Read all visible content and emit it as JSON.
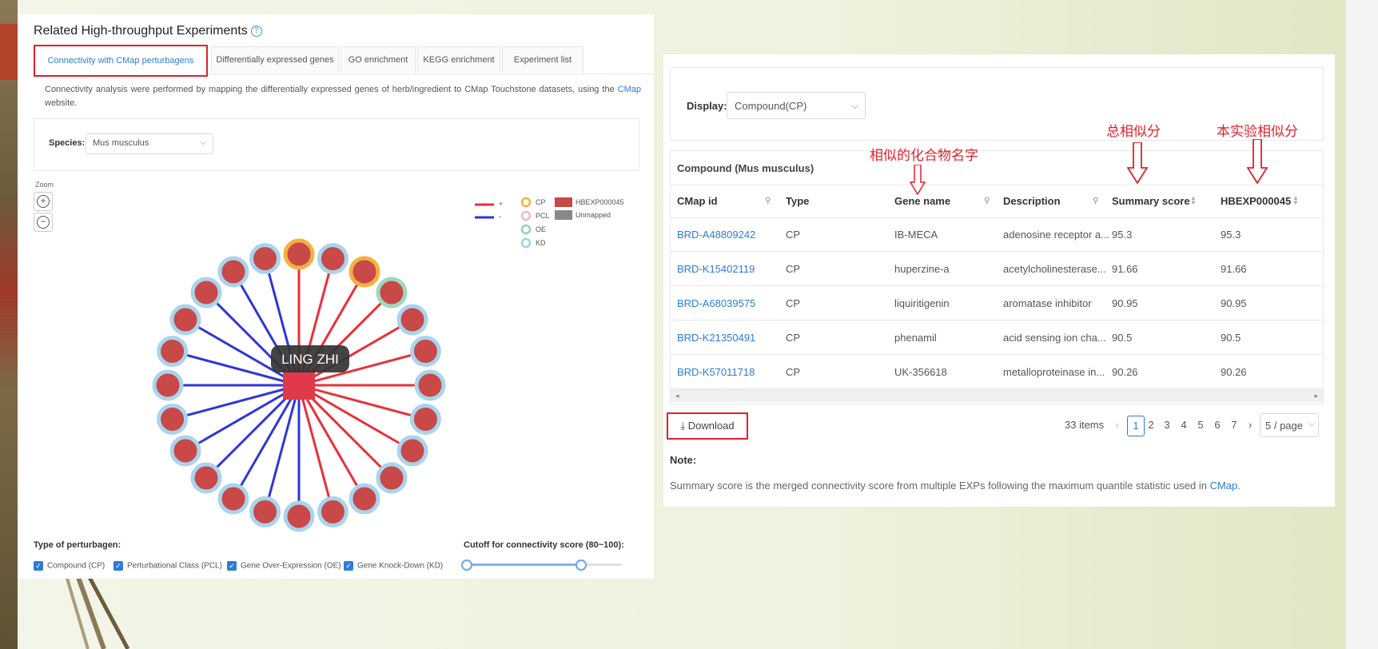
{
  "left": {
    "title": "Related High-throughput Experiments",
    "help_icon": "?",
    "tabs": [
      {
        "label": "Connectivity with CMap perturbagens"
      },
      {
        "label": "Differentially expressed genes"
      },
      {
        "label": "GO enrichment"
      },
      {
        "label": "KEGG enrichment"
      },
      {
        "label": "Experiment list"
      }
    ],
    "description": "Connectivity analysis were performed by mapping the differentially expressed genes of herb/ingredient to CMap Touchstone datasets, using the",
    "description_link": "CMap",
    "description_end": "website.",
    "species_label": "Species:",
    "species_value": "Mus musculus",
    "zoom_label": "Zoom",
    "network_label": "LING ZHI",
    "legend": {
      "plus": "+",
      "minus": "-",
      "cp": "CP",
      "pcl": "PCL",
      "oe": "OE",
      "kd": "KD",
      "exp": "HBEXP000045",
      "unmapped": "Unmapped"
    },
    "perturbagen_label": "Type of perturbagen:",
    "checkboxes": [
      {
        "label": "Compound (CP)"
      },
      {
        "label": "Perturbational Class (PCL)"
      },
      {
        "label": "Gene Over-Expression (OE)"
      },
      {
        "label": "Gene Knock-Down (KD)"
      }
    ],
    "cutoff_label": "Cutoff for connectivity score (80~100):",
    "colors": {
      "positive": "#e8303a",
      "negative": "#2f36d6",
      "node": "#c94848",
      "center": "#e03a4a"
    }
  },
  "right": {
    "display_label": "Display:",
    "display_value": "Compound(CP)",
    "table_caption": "Compound (Mus musculus)",
    "columns": [
      "CMap id",
      "Type",
      "Gene name",
      "Description",
      "Summary score",
      "HBEXP000045"
    ],
    "rows": [
      [
        "BRD-A48809242",
        "CP",
        "IB-MECA",
        "adenosine receptor a...",
        "95.3",
        "95.3"
      ],
      [
        "BRD-K15402119",
        "CP",
        "huperzine-a",
        "acetylcholinesterase...",
        "91.66",
        "91.66"
      ],
      [
        "BRD-A68039575",
        "CP",
        "liquiritigenin",
        "aromatase inhibitor",
        "90.95",
        "90.95"
      ],
      [
        "BRD-K21350491",
        "CP",
        "phenamil",
        "acid sensing ion cha...",
        "90.5",
        "90.5"
      ],
      [
        "BRD-K57011718",
        "CP",
        "UK-356618",
        "metalloproteinase in...",
        "90.26",
        "90.26"
      ]
    ],
    "download_label": "Download",
    "total_items": "33 items",
    "pages": [
      "1",
      "2",
      "3",
      "4",
      "5",
      "6",
      "7"
    ],
    "page_size": "5 / page",
    "note_title": "Note:",
    "note_text": "Summary score is the merged connectivity score from multiple EXPs following the maximum quantile statistic used in",
    "note_link": "CMap."
  },
  "annotations": {
    "gene_name": "相似的化合物名字",
    "summary": "总相似分",
    "experiment": "本实验相似分"
  }
}
